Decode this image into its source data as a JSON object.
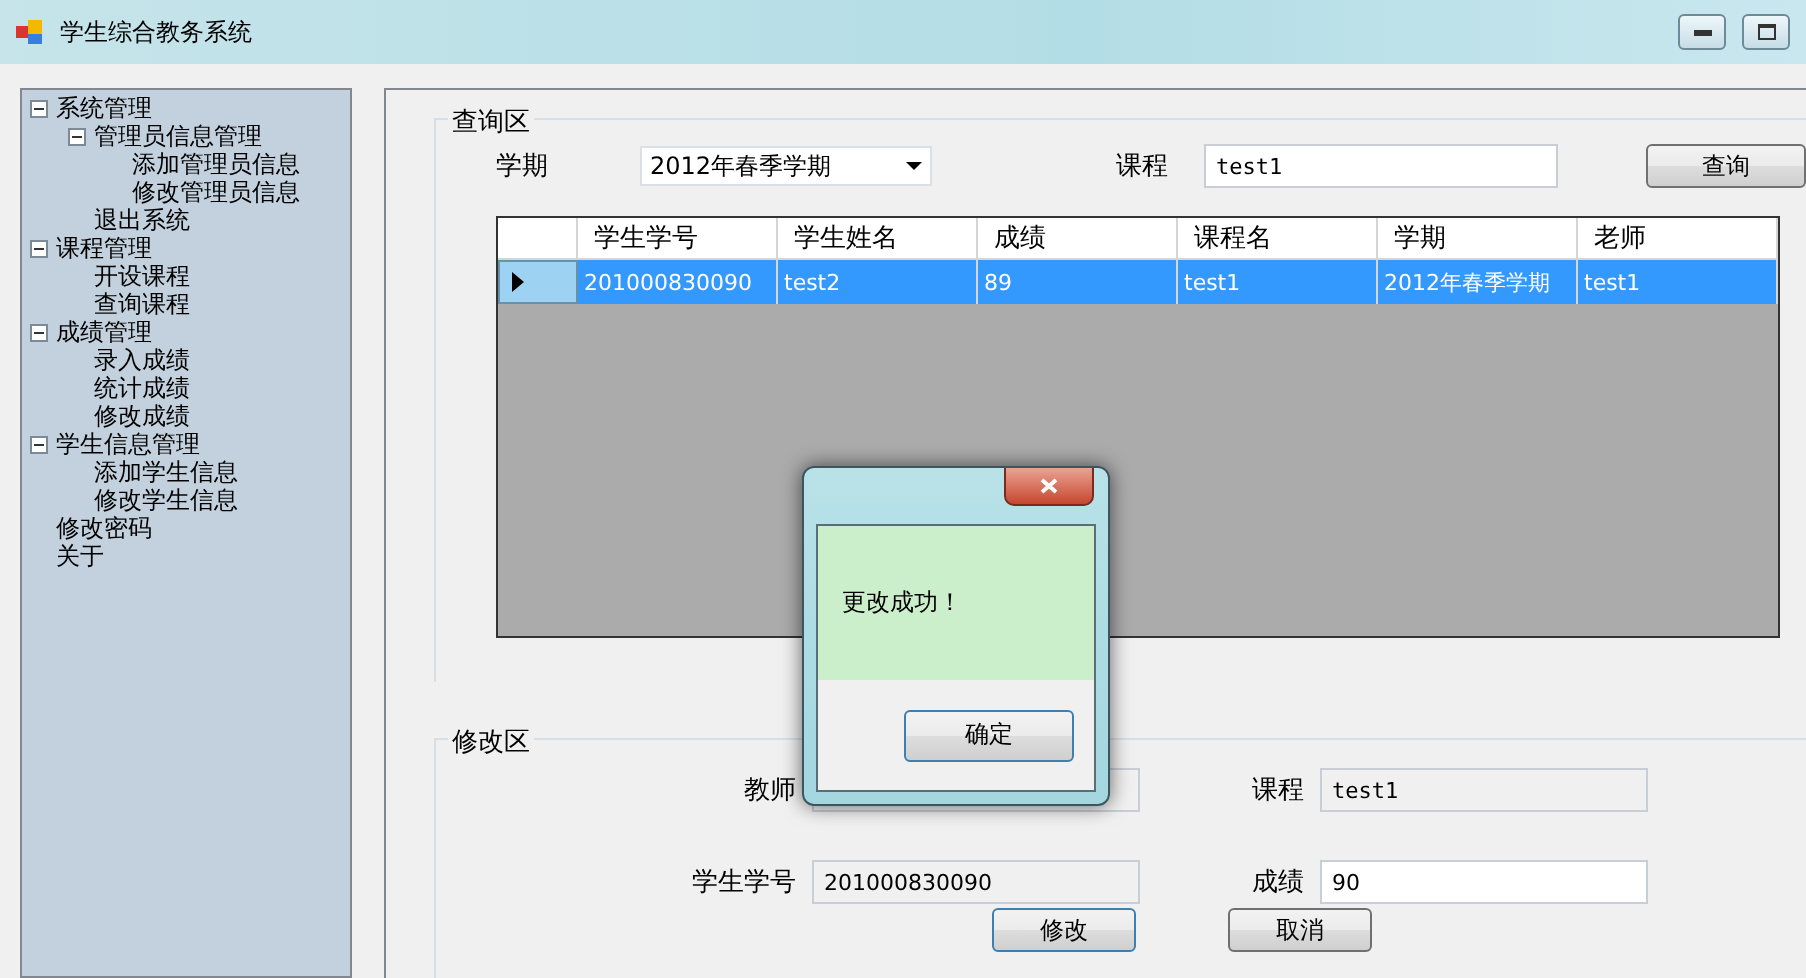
{
  "window": {
    "title": "学生综合教务系统"
  },
  "sidebar": {
    "items": [
      {
        "label": "系统管理",
        "expanded": true,
        "children": [
          {
            "label": "管理员信息管理",
            "expanded": true,
            "children": [
              {
                "label": "添加管理员信息"
              },
              {
                "label": "修改管理员信息"
              }
            ]
          },
          {
            "label": "退出系统"
          }
        ]
      },
      {
        "label": "课程管理",
        "expanded": true,
        "children": [
          {
            "label": "开设课程"
          },
          {
            "label": "查询课程"
          }
        ]
      },
      {
        "label": "成绩管理",
        "expanded": true,
        "children": [
          {
            "label": "录入成绩"
          },
          {
            "label": "统计成绩"
          },
          {
            "label": "修改成绩"
          }
        ]
      },
      {
        "label": "学生信息管理",
        "expanded": true,
        "children": [
          {
            "label": "添加学生信息"
          },
          {
            "label": "修改学生信息"
          }
        ]
      },
      {
        "label": "修改密码"
      },
      {
        "label": "关于"
      }
    ]
  },
  "query": {
    "title": "查询区",
    "term_label": "学期",
    "term_value": "2012年春季学期",
    "course_label": "课程",
    "course_value": "test1",
    "button": "查询"
  },
  "table": {
    "columns": [
      "学生学号",
      "学生姓名",
      "成绩",
      "课程名",
      "学期",
      "老师"
    ],
    "rows": [
      {
        "selected": true,
        "cells": [
          "201000830090",
          "test2",
          "89",
          "test1",
          "2012年春季学期",
          "test1"
        ]
      }
    ]
  },
  "edit": {
    "title": "修改区",
    "teacher_label": "教师",
    "course_label": "课程",
    "course_value": "test1",
    "id_label": "学生学号",
    "id_value": "201000830090",
    "score_label": "成绩",
    "score_value": "90",
    "buttons": [
      "修改",
      "取消"
    ]
  },
  "dialog": {
    "message": "更改成功！",
    "button": "确定"
  }
}
